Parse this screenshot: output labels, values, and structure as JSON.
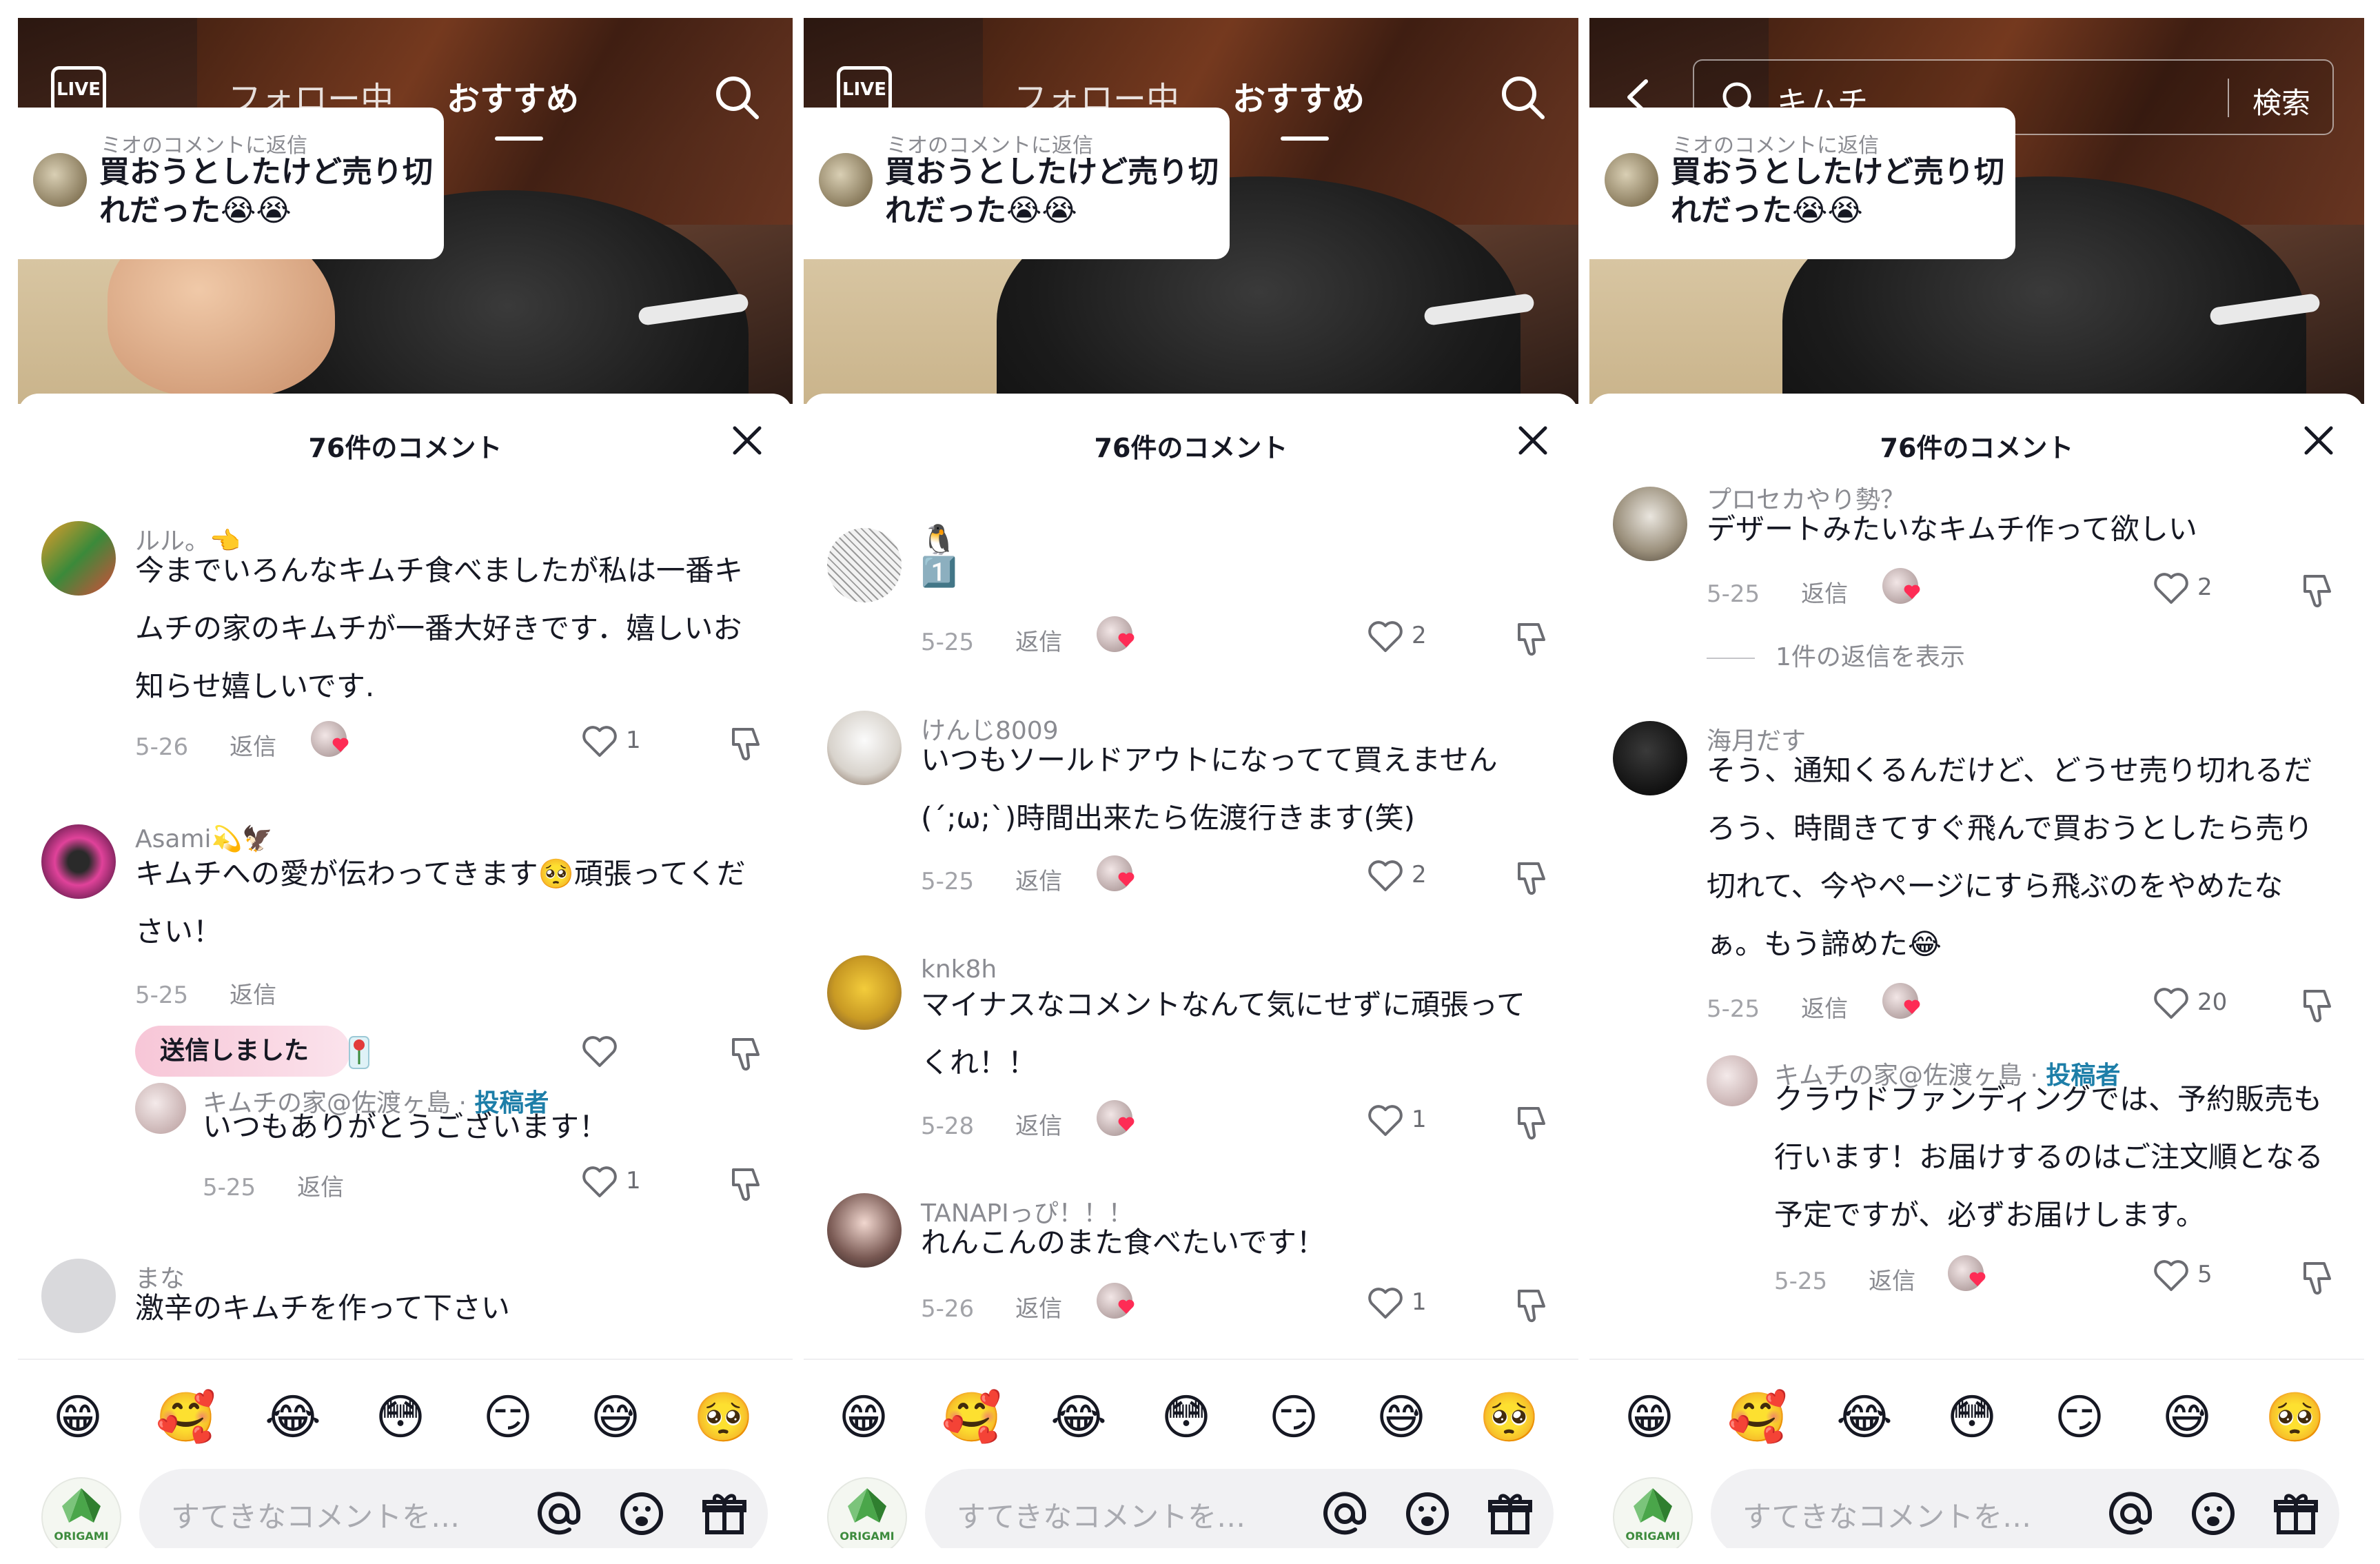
{
  "header": {
    "tab_following": "フォロー中",
    "tab_recommended": "おすすめ",
    "live_label": "LIVE",
    "search_query": "キムチ",
    "search_button": "検索"
  },
  "reply_card": {
    "label": "ミオのコメントに返信",
    "text": "買おうとしたけど売り切れだった😭😭"
  },
  "sheet": {
    "title": "76件のコメント"
  },
  "input": {
    "placeholder": "すてきなコメントを…",
    "origami_label": "ORIGAMI"
  },
  "emojis": [
    "😁",
    "🥰",
    "😂",
    "😳",
    "😏",
    "😅",
    "🥺"
  ],
  "panel1": {
    "comments": [
      {
        "user": "ルル。👈",
        "text": "今までいろんなキムチ食べましたが私は一番キムチの家のキムチが一番大好きです．嬉しいお知らせ嬉しいです.",
        "date": "5-26",
        "reply": "返信",
        "likes": "1"
      },
      {
        "user": "Asami💫🦅",
        "text": "キムチへの愛が伝わってきます🥺頑張ってください！",
        "date": "5-25",
        "reply": "返信",
        "sent": "送信しました",
        "likes": ""
      },
      {
        "user": "キムチの家@佐渡ヶ島 · ",
        "author": "投稿者",
        "text": "いつもありがとうございます！",
        "date": "5-25",
        "reply": "返信",
        "likes": "1"
      },
      {
        "user": "まな",
        "text": "激辛のキムチを作って下さい"
      }
    ]
  },
  "panel2": {
    "comments": [
      {
        "user": "🐧",
        "text": "1️⃣",
        "date": "5-25",
        "reply": "返信",
        "likes": "2"
      },
      {
        "user": "けんじ8009",
        "text": "いつもソールドアウトになってて買えません(´;ω;`)時間出来たら佐渡行きます(笑)",
        "date": "5-25",
        "reply": "返信",
        "likes": "2"
      },
      {
        "user": "knk8h",
        "text": "マイナスなコメントなんて気にせずに頑張ってくれ！！",
        "date": "5-28",
        "reply": "返信",
        "likes": "1"
      },
      {
        "user": "TANAPIっぴ！！！",
        "text": "れんこんのまた食べたいです！",
        "date": "5-26",
        "reply": "返信",
        "likes": "1"
      }
    ]
  },
  "panel3": {
    "comments": [
      {
        "user": "プロセカやり勢？",
        "text": "デザートみたいなキムチ作って欲しい",
        "date": "5-25",
        "reply": "返信",
        "likes": "2",
        "show_replies": "1件の返信を表示"
      },
      {
        "user": "海月だす",
        "text": "そう、通知くるんだけど、どうせ売り切れるだろう、時間きてすぐ飛んで買おうとしたら売り切れて、今やページにすら飛ぶのをやめたなぁ。もう諦めた😂",
        "date": "5-25",
        "reply": "返信",
        "likes": "20"
      },
      {
        "user": "キムチの家@佐渡ヶ島 · ",
        "author": "投稿者",
        "text": "クラウドファンディングでは、予約販売も行います！お届けするのはご注文順となる予定ですが、必ずお届けします。",
        "date": "5-25",
        "reply": "返信",
        "likes": "5"
      }
    ]
  }
}
